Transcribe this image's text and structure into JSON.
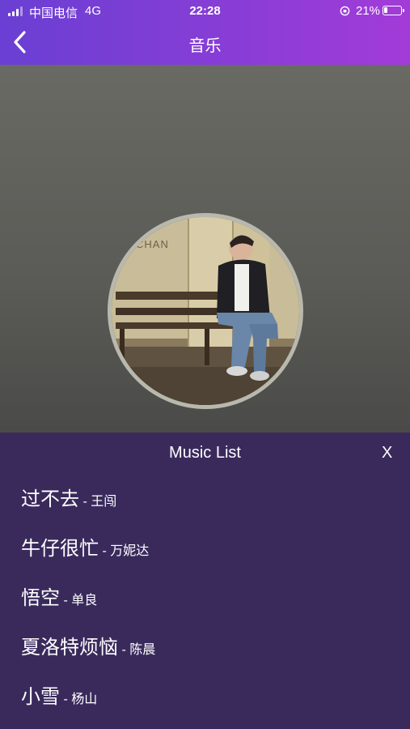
{
  "status_bar": {
    "carrier": "中国电信",
    "network": "4G",
    "time": "22:28",
    "battery": "21%",
    "battery_level": 0.21
  },
  "nav": {
    "title": "音乐",
    "back_icon": "chevron-left-icon"
  },
  "music_list": {
    "title": "Music List",
    "close_label": "X",
    "songs": [
      {
        "name": "过不去",
        "sep": " - ",
        "artist": "王闯"
      },
      {
        "name": "牛仔很忙",
        "sep": " - ",
        "artist": "万妮达"
      },
      {
        "name": "悟空",
        "sep": " - ",
        "artist": "单良"
      },
      {
        "name": "夏洛特烦恼",
        "sep": " - ",
        "artist": "陈晨"
      },
      {
        "name": "小雪",
        "sep": " - ",
        "artist": "杨山"
      }
    ]
  },
  "album_art": {
    "cover_text": "CHAN"
  },
  "colors": {
    "header_gradient_start": "#6a3fd3",
    "header_gradient_end": "#a33bd8",
    "list_bg": "#3a2a5c"
  }
}
